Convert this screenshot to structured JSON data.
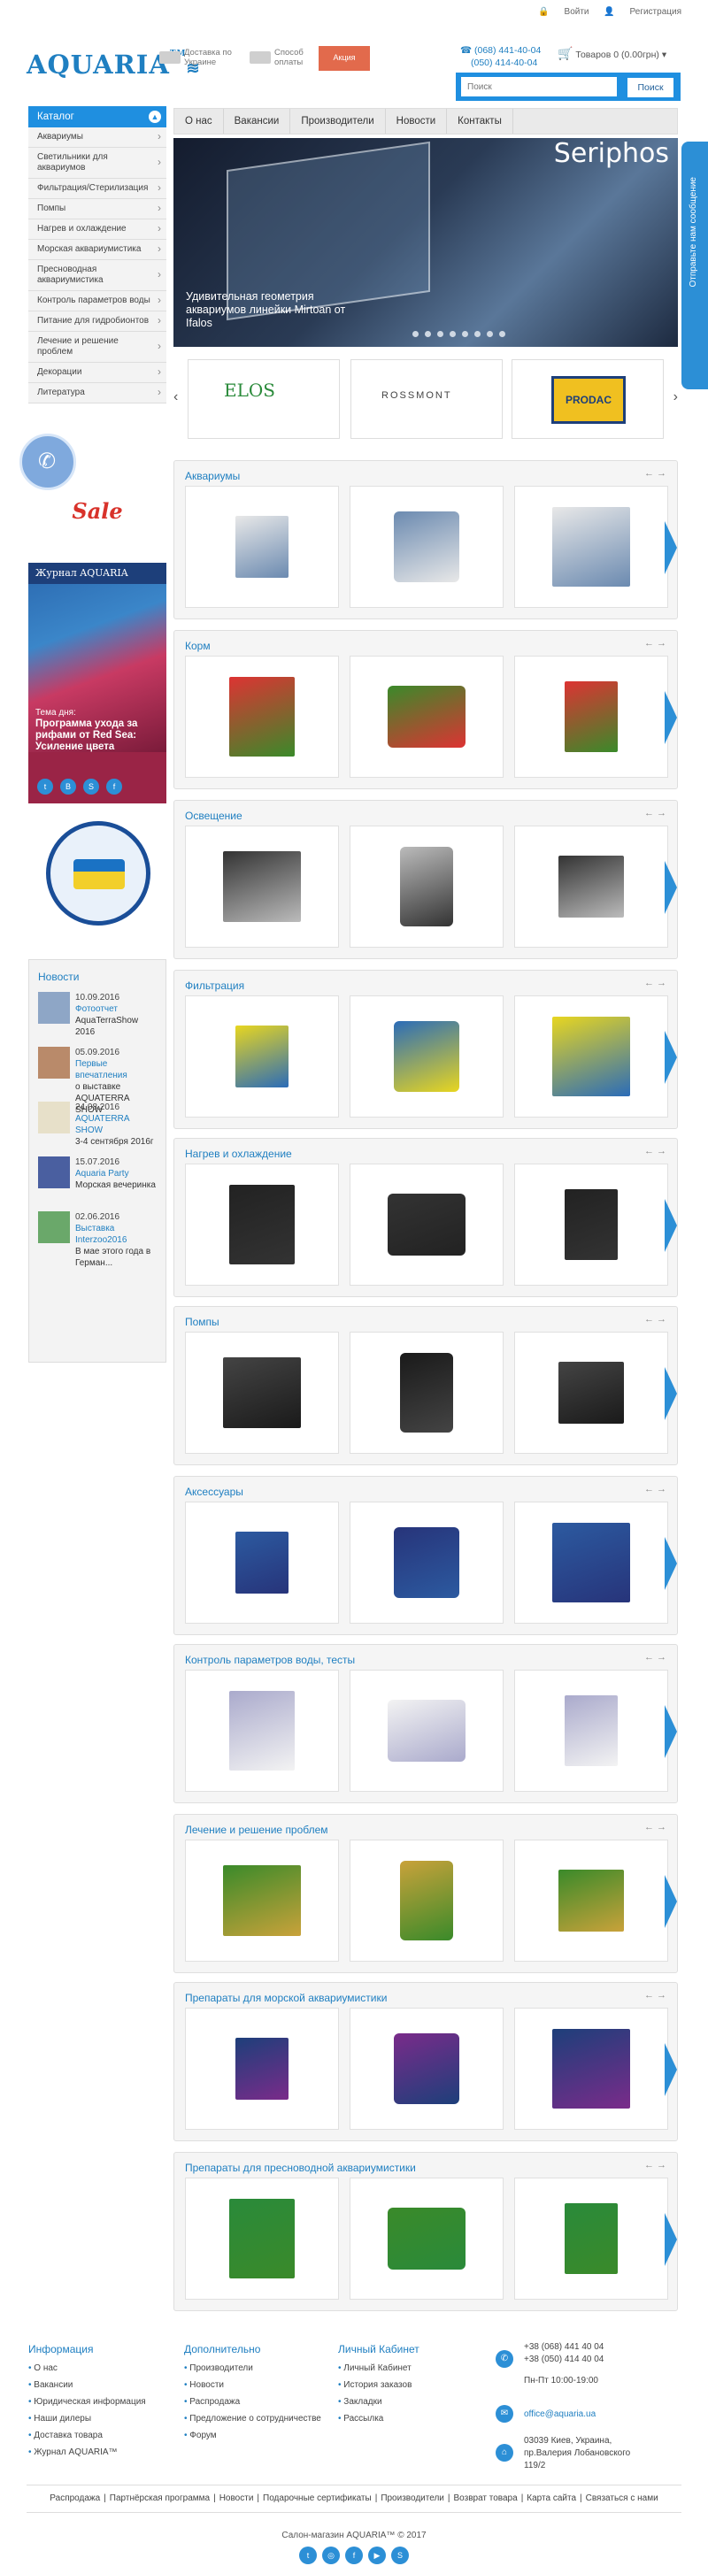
{
  "topbar": {
    "login": "Войти",
    "register": "Регистрация"
  },
  "header": {
    "logo": "AQUARIA",
    "logo_tm": "TM",
    "delivery": "Доставка по Украине",
    "payment": "Способ оплаты",
    "promo": "Акция",
    "phone1": "(068) 441-40-04",
    "phone2": "(050) 414-40-04",
    "cart": "Товаров 0 (0.00грн)",
    "search_placeholder": "Поиск",
    "search_button": "Поиск"
  },
  "nav": [
    "О нас",
    "Вакансии",
    "Производители",
    "Новости",
    "Контакты"
  ],
  "catalog": {
    "title": "Каталог",
    "items": [
      "Аквариумы",
      "Светильники для аквариумов",
      "Фильтрация/Стерилизация",
      "Помпы",
      "Нагрев и охлаждение",
      "Морская аквариумистика",
      "Пресноводная аквариумистика",
      "Контроль параметров воды",
      "Питание для гидробионтов",
      "Лечение и решение проблем",
      "Декорации",
      "Литература"
    ]
  },
  "sale": "Sale",
  "journal": {
    "title": "Журнал AQUARIA",
    "theme_label": "Тема дня:",
    "theme_text": "Программа ухода за рифами от Red Sea: Усиление цвета"
  },
  "news": {
    "title": "Новости",
    "items": [
      {
        "date": "10.09.2016",
        "link": "Фотоотчет",
        "text": "AquaTerraShow 2016"
      },
      {
        "date": "05.09.2016",
        "link": "Первые впечатления",
        "text": "о выставке AQUATERRA SHOW"
      },
      {
        "date": "24.08.2016",
        "link": "AQUATERRA SHOW",
        "text": "3-4 сентября 2016г"
      },
      {
        "date": "15.07.2016",
        "link": "Aquaria Party",
        "text": "Морская вечеринка"
      },
      {
        "date": "02.06.2016",
        "link": "Выставка Interzoo2016",
        "text": "В мае этого года в Герман..."
      }
    ]
  },
  "slider": {
    "brand": "Seriphos",
    "caption": "Удивительная геометрия аквариумов линейки Mirtoan от Ifalos"
  },
  "sidetab": "Отправьте нам сообщение",
  "brands": [
    "ELOS",
    "ROSSMONT",
    "PRODAC"
  ],
  "sections": [
    "Аквариумы",
    "Корм",
    "Освещение",
    "Фильтрация",
    "Нагрев и охлаждение",
    "Помпы",
    "Аксессуары",
    "Контроль параметров воды, тесты",
    "Лечение и решение проблем",
    "Препараты для морской аквариумистики",
    "Препараты для пресноводной аквариумистики"
  ],
  "footer": {
    "col1": {
      "title": "Информация",
      "items": [
        "О нас",
        "Вакансии",
        "Юридическая информация",
        "Наши дилеры",
        "Доставка товара",
        "Журнал AQUARIA™"
      ]
    },
    "col2": {
      "title": "Дополнительно",
      "items": [
        "Производители",
        "Новости",
        "Распродажа",
        "Предложение о сотрудничестве",
        "Форум"
      ]
    },
    "col3": {
      "title": "Личный Кабинет",
      "items": [
        "Личный Кабинет",
        "История заказов",
        "Закладки",
        "Рассылка"
      ]
    },
    "phones": "+38 (068) 441 40 04 +38 (050) 414 40 04",
    "hours": "Пн-Пт 10:00-19:00",
    "email": "office@aquaria.ua",
    "address": "03039 Киев, Украина, пр.Валерия Лобановского 119/2",
    "links": [
      "Распродажа",
      "Партнёрская программа",
      "Новости",
      "Подарочные сертификаты",
      "Производители",
      "Возврат товара",
      "Карта сайта",
      "Связаться с нами"
    ],
    "copyright": "Салон-магазин AQUARIA™ © 2017"
  }
}
